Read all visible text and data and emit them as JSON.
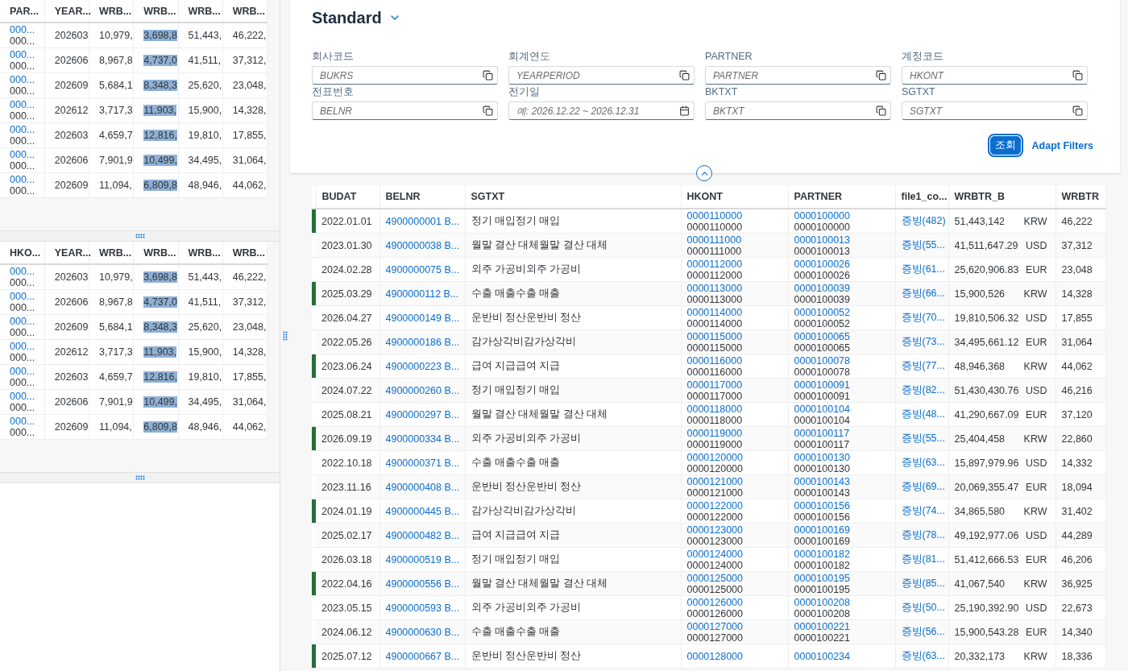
{
  "left_tables": [
    {
      "columns": [
        {
          "label": "PAR...",
          "highlighted": false
        },
        {
          "label": "YEAR...",
          "highlighted": false
        },
        {
          "label": "WRB...",
          "highlighted": false
        },
        {
          "label": "WRB...",
          "highlighted": true
        },
        {
          "label": "WRB...",
          "highlighted": false
        },
        {
          "label": "WRB...",
          "highlighted": false
        }
      ],
      "rows": [
        {
          "cells": [
            [
              "000...",
              "000..."
            ],
            "202603",
            "10,979,",
            "3,698,8",
            "51,443,",
            "46,222,"
          ]
        },
        {
          "cells": [
            [
              "000...",
              "000..."
            ],
            "202606",
            "8,967,8",
            "4,737,0",
            "41,511,",
            "37,312,"
          ]
        },
        {
          "cells": [
            [
              "000...",
              "000..."
            ],
            "202609",
            "5,684,1",
            "8,348,3",
            "25,620,",
            "23,048,"
          ]
        },
        {
          "cells": [
            [
              "000...",
              "000..."
            ],
            "202612",
            "3,717,3",
            "11,903,",
            "15,900,",
            "14,328,"
          ]
        },
        {
          "cells": [
            [
              "000...",
              "000..."
            ],
            "202603",
            "4,659,7",
            "12,816,",
            "19,810,",
            "17,855,"
          ]
        },
        {
          "cells": [
            [
              "000...",
              "000..."
            ],
            "202606",
            "7,901,9",
            "10,499,",
            "34,495,",
            "31,064,"
          ]
        },
        {
          "cells": [
            [
              "000...",
              "000..."
            ],
            "202609",
            "11,094,",
            "6,809,8",
            "48,946,",
            "44,062,"
          ]
        }
      ]
    },
    {
      "columns": [
        {
          "label": "HKO...",
          "highlighted": false
        },
        {
          "label": "YEAR...",
          "highlighted": false
        },
        {
          "label": "WRB...",
          "highlighted": false
        },
        {
          "label": "WRB...",
          "highlighted": true
        },
        {
          "label": "WRB...",
          "highlighted": false
        },
        {
          "label": "WRB...",
          "highlighted": false
        }
      ],
      "rows": [
        {
          "cells": [
            [
              "000...",
              "000..."
            ],
            "202603",
            "10,979,",
            "3,698,8",
            "51,443,",
            "46,222,"
          ]
        },
        {
          "cells": [
            [
              "000...",
              "000..."
            ],
            "202606",
            "8,967,8",
            "4,737,0",
            "41,511,",
            "37,312,"
          ]
        },
        {
          "cells": [
            [
              "000...",
              "000..."
            ],
            "202609",
            "5,684,1",
            "8,348,3",
            "25,620,",
            "23,048,"
          ]
        },
        {
          "cells": [
            [
              "000...",
              "000..."
            ],
            "202612",
            "3,717,3",
            "11,903,",
            "15,900,",
            "14,328,"
          ]
        },
        {
          "cells": [
            [
              "000...",
              "000..."
            ],
            "202603",
            "4,659,7",
            "12,816,",
            "19,810,",
            "17,855,"
          ]
        },
        {
          "cells": [
            [
              "000...",
              "000..."
            ],
            "202606",
            "7,901,9",
            "10,499,",
            "34,495,",
            "31,064,"
          ]
        },
        {
          "cells": [
            [
              "000...",
              "000..."
            ],
            "202609",
            "11,094,",
            "6,809,8",
            "48,946,",
            "44,062,"
          ]
        }
      ]
    }
  ],
  "filter_bar": {
    "title": "Standard",
    "fields": [
      {
        "label": "회사코드",
        "placeholder": "BUKRS",
        "kind": "value-help"
      },
      {
        "label": "회계연도",
        "placeholder": "YEARPERIOD",
        "kind": "value-help"
      },
      {
        "label": "PARTNER",
        "placeholder": "PARTNER",
        "kind": "value-help"
      },
      {
        "label": "계정코드",
        "placeholder": "HKONT",
        "kind": "value-help"
      },
      {
        "label": "전표번호",
        "placeholder": "BELNR",
        "kind": "value-help"
      },
      {
        "label": "전기일",
        "placeholder": "예: 2026.12.22 ~ 2026.12.31",
        "kind": "date"
      },
      {
        "label": "BKTXT",
        "placeholder": "BKTXT",
        "kind": "value-help"
      },
      {
        "label": "SGTXT",
        "placeholder": "SGTXT",
        "kind": "value-help"
      }
    ],
    "buttons": [
      {
        "label": "조회",
        "kind": "emphasized"
      },
      {
        "label": "Adapt Filters",
        "kind": "transparent"
      }
    ]
  },
  "table": {
    "columns": [
      "BUDAT",
      "BELNR",
      "SGTXT",
      "HKONT",
      "PARTNER",
      "file1_co...",
      "WRBTR_B",
      "WRBTR"
    ],
    "rows": [
      {
        "marked": true,
        "budat": "2022.01.01",
        "belnr": "4900000001 B...",
        "sgtxt": "정기 매입정기 매입",
        "hkont": [
          "0000110000",
          "0000110000"
        ],
        "partner": [
          "0000100000",
          "0000100000"
        ],
        "file": "증빙(482)",
        "amount": "51,443,142",
        "currency": "KRW",
        "wrbtr": "46,222"
      },
      {
        "marked": false,
        "budat": "2023.01.30",
        "belnr": "4900000038 B...",
        "sgtxt": "월말 결산 대체월말 결산 대체",
        "hkont": [
          "0000111000",
          "0000111000"
        ],
        "partner": [
          "0000100013",
          "0000100013"
        ],
        "file": "증빙(55...",
        "amount": "41,511,647.29",
        "currency": "USD",
        "wrbtr": "37,312"
      },
      {
        "marked": false,
        "budat": "2024.02.28",
        "belnr": "4900000075 B...",
        "sgtxt": "외주 가공비외주 가공비",
        "hkont": [
          "0000112000",
          "0000112000"
        ],
        "partner": [
          "0000100026",
          "0000100026"
        ],
        "file": "증빙(61...",
        "amount": "25,620,906.83",
        "currency": "EUR",
        "wrbtr": "23,048"
      },
      {
        "marked": true,
        "budat": "2025.03.29",
        "belnr": "4900000112 B...",
        "sgtxt": "수출 매출수출 매출",
        "hkont": [
          "0000113000",
          "0000113000"
        ],
        "partner": [
          "0000100039",
          "0000100039"
        ],
        "file": "증빙(66...",
        "amount": "15,900,526",
        "currency": "KRW",
        "wrbtr": "14,328"
      },
      {
        "marked": false,
        "budat": "2026.04.27",
        "belnr": "4900000149 B...",
        "sgtxt": "운반비 정산운반비 정산",
        "hkont": [
          "0000114000",
          "0000114000"
        ],
        "partner": [
          "0000100052",
          "0000100052"
        ],
        "file": "증빙(70...",
        "amount": "19,810,506.32",
        "currency": "USD",
        "wrbtr": "17,855"
      },
      {
        "marked": false,
        "budat": "2022.05.26",
        "belnr": "4900000186 B...",
        "sgtxt": "감가상각비감가상각비",
        "hkont": [
          "0000115000",
          "0000115000"
        ],
        "partner": [
          "0000100065",
          "0000100065"
        ],
        "file": "증빙(73...",
        "amount": "34,495,661.12",
        "currency": "EUR",
        "wrbtr": "31,064"
      },
      {
        "marked": true,
        "budat": "2023.06.24",
        "belnr": "4900000223 B...",
        "sgtxt": "급여 지급급여 지급",
        "hkont": [
          "0000116000",
          "0000116000"
        ],
        "partner": [
          "0000100078",
          "0000100078"
        ],
        "file": "증빙(77...",
        "amount": "48,946,368",
        "currency": "KRW",
        "wrbtr": "44,062"
      },
      {
        "marked": false,
        "budat": "2024.07.22",
        "belnr": "4900000260 B...",
        "sgtxt": "정기 매입정기 매입",
        "hkont": [
          "0000117000",
          "0000117000"
        ],
        "partner": [
          "0000100091",
          "0000100091"
        ],
        "file": "증빙(82...",
        "amount": "51,430,430.76",
        "currency": "USD",
        "wrbtr": "46,216"
      },
      {
        "marked": false,
        "budat": "2025.08.21",
        "belnr": "4900000297 B...",
        "sgtxt": "월말 결산 대체월말 결산 대체",
        "hkont": [
          "0000118000",
          "0000118000"
        ],
        "partner": [
          "0000100104",
          "0000100104"
        ],
        "file": "증빙(48...",
        "amount": "41,290,667.09",
        "currency": "EUR",
        "wrbtr": "37,120"
      },
      {
        "marked": true,
        "budat": "2026.09.19",
        "belnr": "4900000334 B...",
        "sgtxt": "외주 가공비외주 가공비",
        "hkont": [
          "0000119000",
          "0000119000"
        ],
        "partner": [
          "0000100117",
          "0000100117"
        ],
        "file": "증빙(55...",
        "amount": "25,404,458",
        "currency": "KRW",
        "wrbtr": "22,860"
      },
      {
        "marked": false,
        "budat": "2022.10.18",
        "belnr": "4900000371 B...",
        "sgtxt": "수출 매출수출 매출",
        "hkont": [
          "0000120000",
          "0000120000"
        ],
        "partner": [
          "0000100130",
          "0000100130"
        ],
        "file": "증빙(63...",
        "amount": "15,897,979.96",
        "currency": "USD",
        "wrbtr": "14,332"
      },
      {
        "marked": false,
        "budat": "2023.11.16",
        "belnr": "4900000408 B...",
        "sgtxt": "운반비 정산운반비 정산",
        "hkont": [
          "0000121000",
          "0000121000"
        ],
        "partner": [
          "0000100143",
          "0000100143"
        ],
        "file": "증빙(69...",
        "amount": "20,069,355.47",
        "currency": "EUR",
        "wrbtr": "18,094"
      },
      {
        "marked": true,
        "budat": "2024.01.19",
        "belnr": "4900000445 B...",
        "sgtxt": "감가상각비감가상각비",
        "hkont": [
          "0000122000",
          "0000122000"
        ],
        "partner": [
          "0000100156",
          "0000100156"
        ],
        "file": "증빙(74...",
        "amount": "34,865,580",
        "currency": "KRW",
        "wrbtr": "31,402"
      },
      {
        "marked": false,
        "budat": "2025.02.17",
        "belnr": "4900000482 B...",
        "sgtxt": "급여 지급급여 지급",
        "hkont": [
          "0000123000",
          "0000123000"
        ],
        "partner": [
          "0000100169",
          "0000100169"
        ],
        "file": "증빙(78...",
        "amount": "49,192,977.06",
        "currency": "USD",
        "wrbtr": "44,289"
      },
      {
        "marked": false,
        "budat": "2026.03.18",
        "belnr": "4900000519 B...",
        "sgtxt": "정기 매입정기 매입",
        "hkont": [
          "0000124000",
          "0000124000"
        ],
        "partner": [
          "0000100182",
          "0000100182"
        ],
        "file": "증빙(81...",
        "amount": "51,412,666.53",
        "currency": "EUR",
        "wrbtr": "46,206"
      },
      {
        "marked": true,
        "budat": "2022.04.16",
        "belnr": "4900000556 B...",
        "sgtxt": "월말 결산 대체월말 결산 대체",
        "hkont": [
          "0000125000",
          "0000125000"
        ],
        "partner": [
          "0000100195",
          "0000100195"
        ],
        "file": "증빙(85...",
        "amount": "41,067,540",
        "currency": "KRW",
        "wrbtr": "36,925"
      },
      {
        "marked": false,
        "budat": "2023.05.15",
        "belnr": "4900000593 B...",
        "sgtxt": "외주 가공비외주 가공비",
        "hkont": [
          "0000126000",
          "0000126000"
        ],
        "partner": [
          "0000100208",
          "0000100208"
        ],
        "file": "증빙(50...",
        "amount": "25,190,392.90",
        "currency": "USD",
        "wrbtr": "22,673"
      },
      {
        "marked": false,
        "budat": "2024.06.12",
        "belnr": "4900000630 B...",
        "sgtxt": "수출 매출수출 매출",
        "hkont": [
          "0000127000",
          "0000127000"
        ],
        "partner": [
          "0000100221",
          "0000100221"
        ],
        "file": "증빙(56...",
        "amount": "15,900,543.28",
        "currency": "EUR",
        "wrbtr": "14,340"
      },
      {
        "marked": true,
        "budat": "2025.07.12",
        "belnr": "4900000667 B...",
        "sgtxt": "운반비 정산운반비 정산",
        "hkont": [
          "0000128000"
        ],
        "partner": [
          "0000100234"
        ],
        "file": "증빙(63...",
        "amount": "20,332,173",
        "currency": "KRW",
        "wrbtr": "18,336"
      }
    ]
  }
}
